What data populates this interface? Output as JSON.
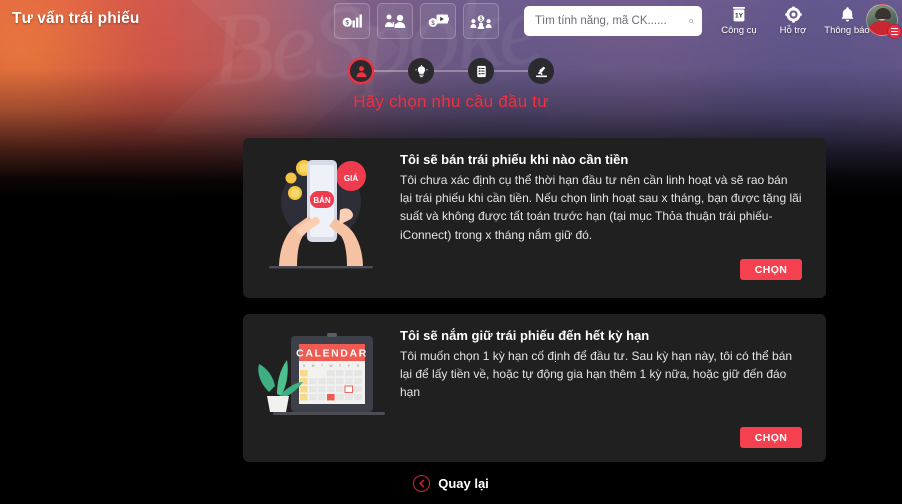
{
  "header": {
    "brand": "Tư vấn trái phiếu",
    "watermark": "BeSpoke",
    "nav_icons": [
      {
        "name": "market-chart-icon",
        "label": "Thị trường"
      },
      {
        "name": "community-people-icon",
        "label": "Cộng đồng"
      },
      {
        "name": "video-money-icon",
        "label": "Video"
      },
      {
        "name": "investor-group-icon",
        "label": "Đầu tư"
      }
    ],
    "search": {
      "placeholder": "Tìm tính năng, mã CK......",
      "value": "",
      "icon": "search-icon"
    },
    "items": [
      {
        "icon": "tools-icon",
        "label": "Công cụ"
      },
      {
        "icon": "support-icon",
        "label": "Hỗ trợ"
      },
      {
        "icon": "bell-icon",
        "label": "Thông báo"
      }
    ],
    "avatar": {
      "name": "user-avatar",
      "badge_icon": "menu-badge-icon"
    }
  },
  "steps": {
    "items": [
      {
        "icon": "person-icon",
        "active": true
      },
      {
        "icon": "lightbulb-icon",
        "active": false
      },
      {
        "icon": "list-document-icon",
        "active": false
      },
      {
        "icon": "gavel-icon",
        "active": false
      }
    ]
  },
  "page_title": "Hãy chọn nhu cầu đầu tư",
  "cards": [
    {
      "illustration": "hand-phone-sell-illustration",
      "title": "Tôi sẽ bán trái phiếu khi nào cần tiền",
      "description": "Tôi chưa xác định cụ thể thời hạn đầu tư nên cần linh hoạt và sẽ rao bán lại trái phiếu khi cần tiền. Nếu chọn linh hoạt sau x tháng, bạn được tặng lãi suất và không được tất toán trước hạn (tại mục Thỏa thuận trái phiếu- iConnect) trong x tháng nắm giữ đó.",
      "button_label": "CHỌN"
    },
    {
      "illustration": "calendar-laptop-illustration",
      "title": "Tôi sẽ nắm giữ trái phiếu đến hết kỳ hạn",
      "description": "Tôi muốn chọn 1 kỳ hạn cố định để đầu tư. Sau kỳ hạn này, tôi có thể bán lại để lấy tiền về, hoặc tự động gia hạn thêm 1 kỳ nữa, hoặc giữ đến đáo hạn",
      "button_label": "CHỌN"
    }
  ],
  "footer": {
    "back_label": "Quay lại",
    "back_icon": "chevron-left-circle-icon"
  },
  "colors": {
    "accent_red": "#f5404f",
    "title_red": "#f0303f",
    "card_bg": "#202020",
    "page_bg": "#000000"
  }
}
